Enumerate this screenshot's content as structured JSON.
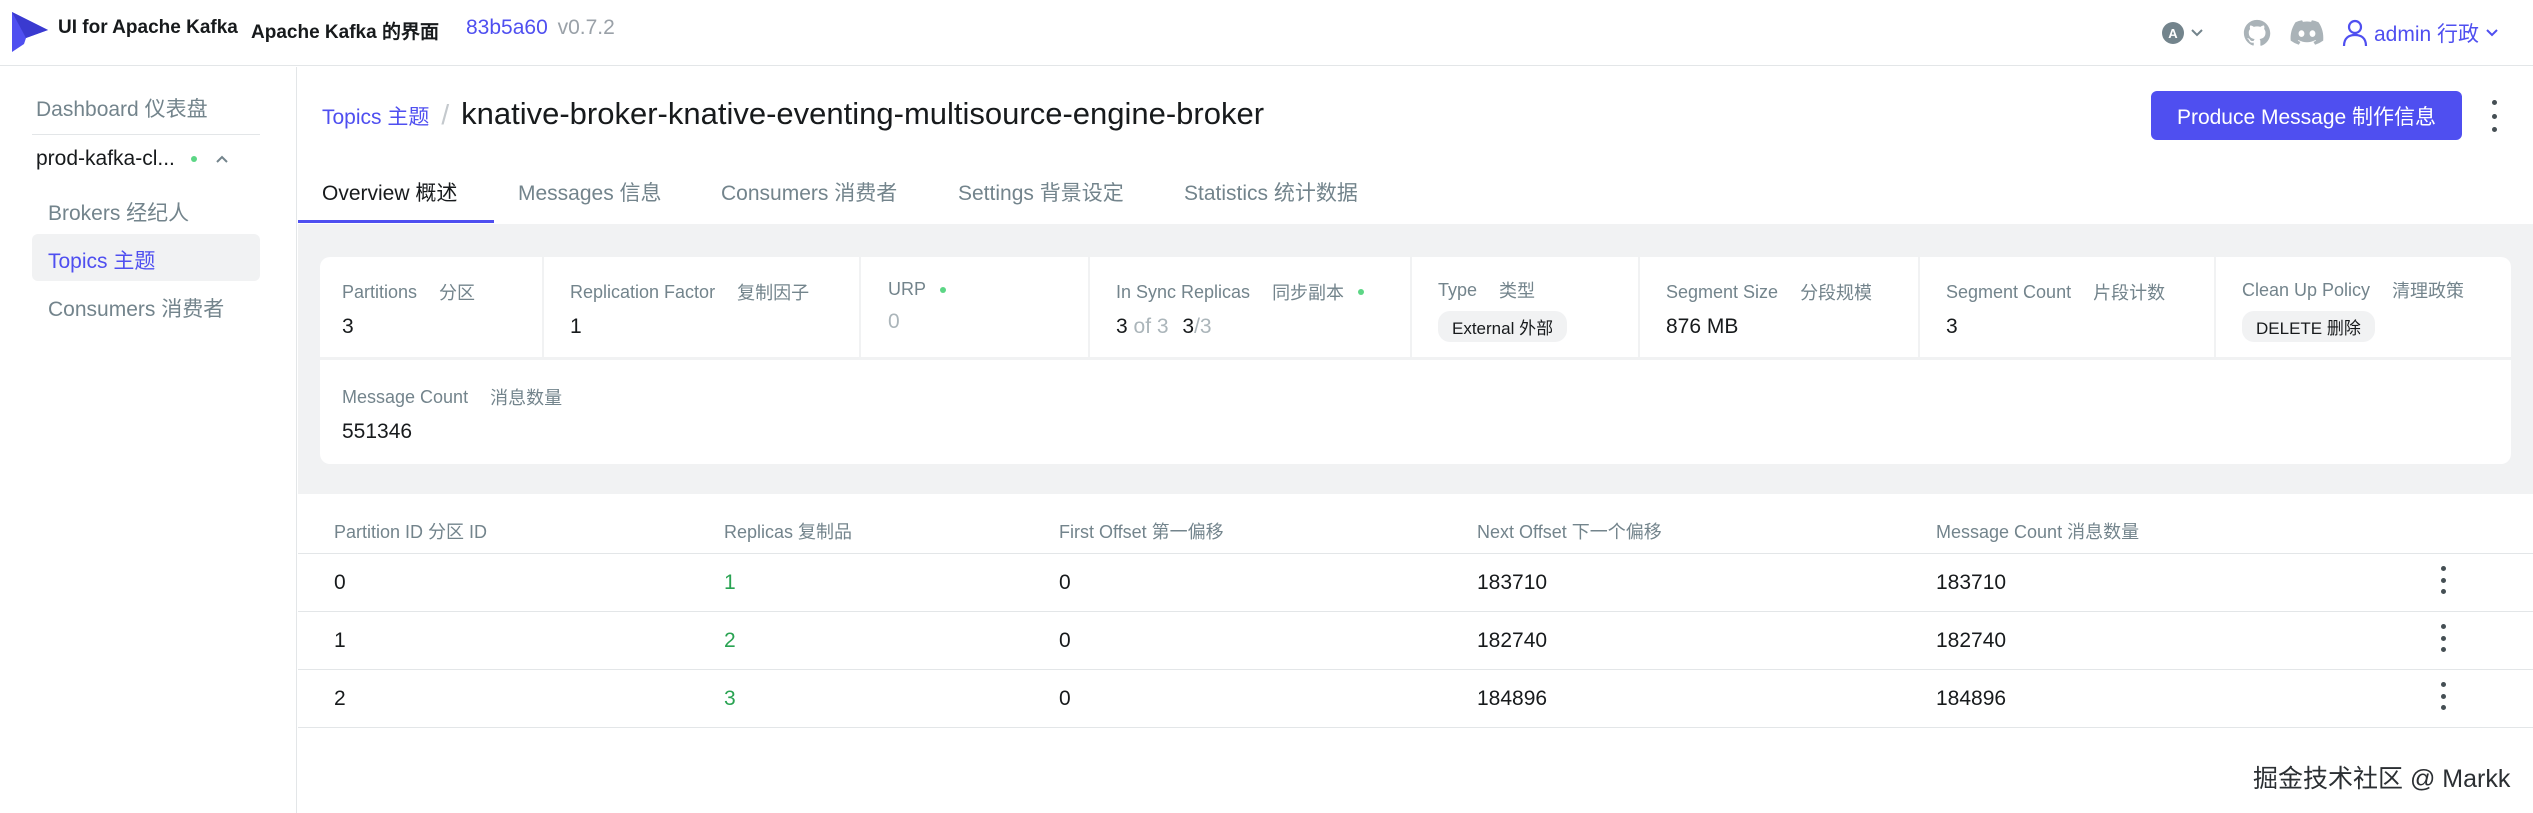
{
  "navbar": {
    "brand": "UI for Apache Kafka",
    "brand_cn": "Apache Kafka 的界面",
    "version_hash": "83b5a60",
    "version": "v0.7.2",
    "theme_letter": "A",
    "user": "admin  行政"
  },
  "sidebar": {
    "dashboard": "Dashboard  仪表盘",
    "cluster": "prod-kafka-cl...",
    "items": [
      {
        "label": "Brokers  经纪人"
      },
      {
        "label": "Topics  主题"
      },
      {
        "label": "Consumers  消费者"
      }
    ]
  },
  "header": {
    "breadcrumb": "Topics  主题",
    "separator": "/",
    "title": "knative-broker-knative-eventing-multisource-engine-broker",
    "produce_button": "Produce Message  制作信息"
  },
  "tabs": [
    {
      "label": "Overview  概述",
      "active": true
    },
    {
      "label": "Messages  信息"
    },
    {
      "label": "Consumers  消费者"
    },
    {
      "label": "Settings  背景设定"
    },
    {
      "label": "Statistics  统计数据"
    }
  ],
  "stats": {
    "partitions": {
      "label": "Partitions",
      "label_cn": "分区",
      "value": "3"
    },
    "replication_factor": {
      "label": "Replication Factor",
      "label_cn": "复制因子",
      "value": "1"
    },
    "urp": {
      "label": "URP",
      "value": "0"
    },
    "in_sync": {
      "label": "In Sync Replicas",
      "label_cn": "同步副本",
      "value": "3",
      "of": "of 3",
      "ratio_num": "3",
      "ratio_den": "/3"
    },
    "type": {
      "label": "Type",
      "label_cn": "类型",
      "value": "External  外部"
    },
    "segment_size": {
      "label": "Segment Size",
      "label_cn": "分段规模",
      "value": "876 MB"
    },
    "segment_count": {
      "label": "Segment Count",
      "label_cn": "片段计数",
      "value": "3"
    },
    "cleanup_policy": {
      "label": "Clean Up Policy",
      "label_cn": "清理政策",
      "value": "DELETE  删除"
    },
    "message_count": {
      "label": "Message Count",
      "label_cn": "消息数量",
      "value": "551346"
    }
  },
  "table": {
    "columns": [
      "Partition ID  分区 ID",
      "Replicas  复制品",
      "First Offset  第一偏移",
      "Next Offset  下一个偏移",
      "Message Count  消息数量"
    ],
    "rows": [
      {
        "partition": "0",
        "replicas": "1",
        "first_offset": "0",
        "next_offset": "183710",
        "message_count": "183710"
      },
      {
        "partition": "1",
        "replicas": "2",
        "first_offset": "0",
        "next_offset": "182740",
        "message_count": "182740"
      },
      {
        "partition": "2",
        "replicas": "3",
        "first_offset": "0",
        "next_offset": "184896",
        "message_count": "184896"
      }
    ]
  },
  "watermark": "掘金技术社区 @ Markk",
  "colors": {
    "accent": "#4f4ff0",
    "success": "#29a352",
    "status_dot": "#5cd685",
    "muted": "#73848c"
  }
}
